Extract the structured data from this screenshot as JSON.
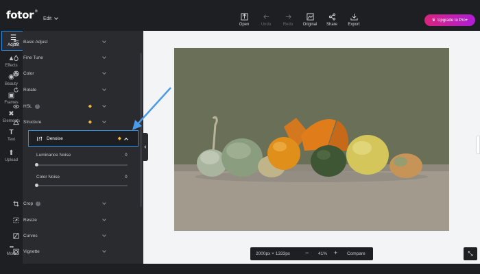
{
  "app": {
    "logo": "fotor",
    "logo_mark": "®",
    "edit_label": "Edit"
  },
  "toolbar": [
    {
      "label": "Open",
      "icon": "open-icon",
      "enabled": true
    },
    {
      "label": "Undo",
      "icon": "undo-icon",
      "enabled": false
    },
    {
      "label": "Redo",
      "icon": "redo-icon",
      "enabled": false
    },
    {
      "label": "Original",
      "icon": "original-icon",
      "enabled": true
    },
    {
      "label": "Share",
      "icon": "share-icon",
      "enabled": true
    },
    {
      "label": "Export",
      "icon": "export-icon",
      "enabled": true
    }
  ],
  "upgrade": {
    "label": "Upgrade to Pro+",
    "icon": "crown-icon"
  },
  "rail": [
    {
      "label": "Adjust",
      "icon": "sliders-icon",
      "active": true
    },
    {
      "label": "Effects",
      "icon": "flask-icon",
      "active": false
    },
    {
      "label": "Beauty",
      "icon": "eye-icon",
      "active": false
    },
    {
      "label": "Frames",
      "icon": "frame-icon",
      "active": false
    },
    {
      "label": "Elements",
      "icon": "elements-icon",
      "active": false
    },
    {
      "label": "Text",
      "icon": "text-icon",
      "active": false
    },
    {
      "label": "Upload",
      "icon": "upload-icon",
      "active": false
    },
    {
      "label": "More",
      "icon": "more-icon",
      "active": false
    }
  ],
  "panel": {
    "items": [
      {
        "label": "Basic Adjust",
        "icon": "sliders-icon",
        "pro": false,
        "help": false
      },
      {
        "label": "Fine Tune",
        "icon": "droplet-icon",
        "pro": false,
        "help": false
      },
      {
        "label": "Color",
        "icon": "color-icon",
        "pro": false,
        "help": false
      },
      {
        "label": "Rotate",
        "icon": "rotate-icon",
        "pro": false,
        "help": false
      },
      {
        "label": "HSL",
        "icon": "hsl-icon",
        "pro": true,
        "help": true
      },
      {
        "label": "Structure",
        "icon": "triangle-icon",
        "pro": true,
        "help": false
      },
      {
        "label": "Denoise",
        "icon": "denoise-icon",
        "pro": true,
        "help": false,
        "expanded": true
      },
      {
        "label": "Crop",
        "icon": "crop-icon",
        "pro": false,
        "help": true
      },
      {
        "label": "Resize",
        "icon": "resize-icon",
        "pro": false,
        "help": false
      },
      {
        "label": "Curves",
        "icon": "curves-icon",
        "pro": false,
        "help": false
      },
      {
        "label": "Vignette",
        "icon": "vignette-icon",
        "pro": false,
        "help": false
      }
    ],
    "denoise": {
      "luminance_label": "Luminance Noise",
      "luminance_value": "0",
      "color_label": "Color Noise",
      "color_value": "0"
    }
  },
  "canvas": {
    "dimensions": "2000px × 1333px",
    "zoom": "41%",
    "zoom_out": "−",
    "zoom_in": "+",
    "compare": "Compare"
  },
  "colors": {
    "accent": "#2b8ee8",
    "pro_badge": "#f0b93a",
    "upgrade_gradient_start": "#d8247c",
    "upgrade_gradient_end": "#b01dd8"
  }
}
